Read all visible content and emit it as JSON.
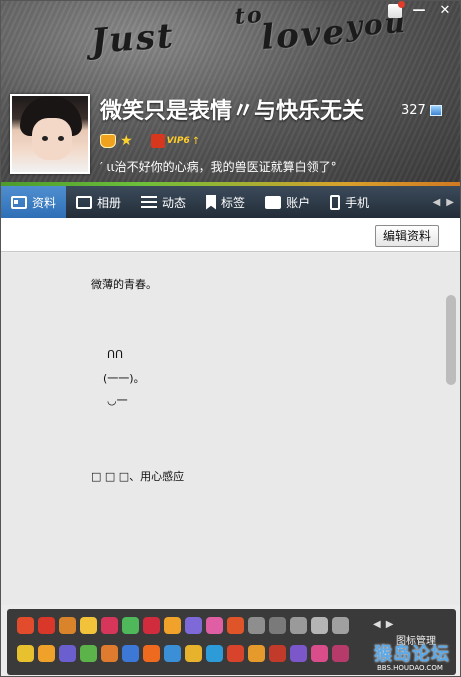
{
  "window": {
    "controls": {
      "skin_icon": "skin-icon",
      "minimize_label": "—",
      "close_label": "✕"
    }
  },
  "header": {
    "art_text": [
      "Just",
      "to",
      "love",
      "you"
    ],
    "nickname": "微笑只是表情〃与快乐无关",
    "level": "327",
    "vip_label": "VIP6",
    "signature": "′ ιι治不好你的心病，我的兽医证就算白领了°",
    "accent_colors": [
      "#4c9b2c",
      "#d07a22"
    ]
  },
  "tabs": [
    {
      "label": "资料",
      "icon": "profile-card-icon",
      "active": true
    },
    {
      "label": "相册",
      "icon": "photo-album-icon",
      "active": false
    },
    {
      "label": "动态",
      "icon": "list-icon",
      "active": false
    },
    {
      "label": "标签",
      "icon": "bookmark-icon",
      "active": false
    },
    {
      "label": "账户",
      "icon": "wallet-icon",
      "active": false
    },
    {
      "label": "手机",
      "icon": "phone-icon",
      "active": false
    }
  ],
  "toolbar": {
    "edit_label": "编辑资料"
  },
  "bio": {
    "lines": [
      "微薄的青春。",
      "ᑎᑎ",
      "(一一)。",
      "◡一",
      "□ □ □、用心感应"
    ]
  },
  "emoji_panel": {
    "manage_label": "图标管理",
    "watermark": "猴岛论坛",
    "watermark_sub": "BBS.HOUDAO.COM"
  }
}
